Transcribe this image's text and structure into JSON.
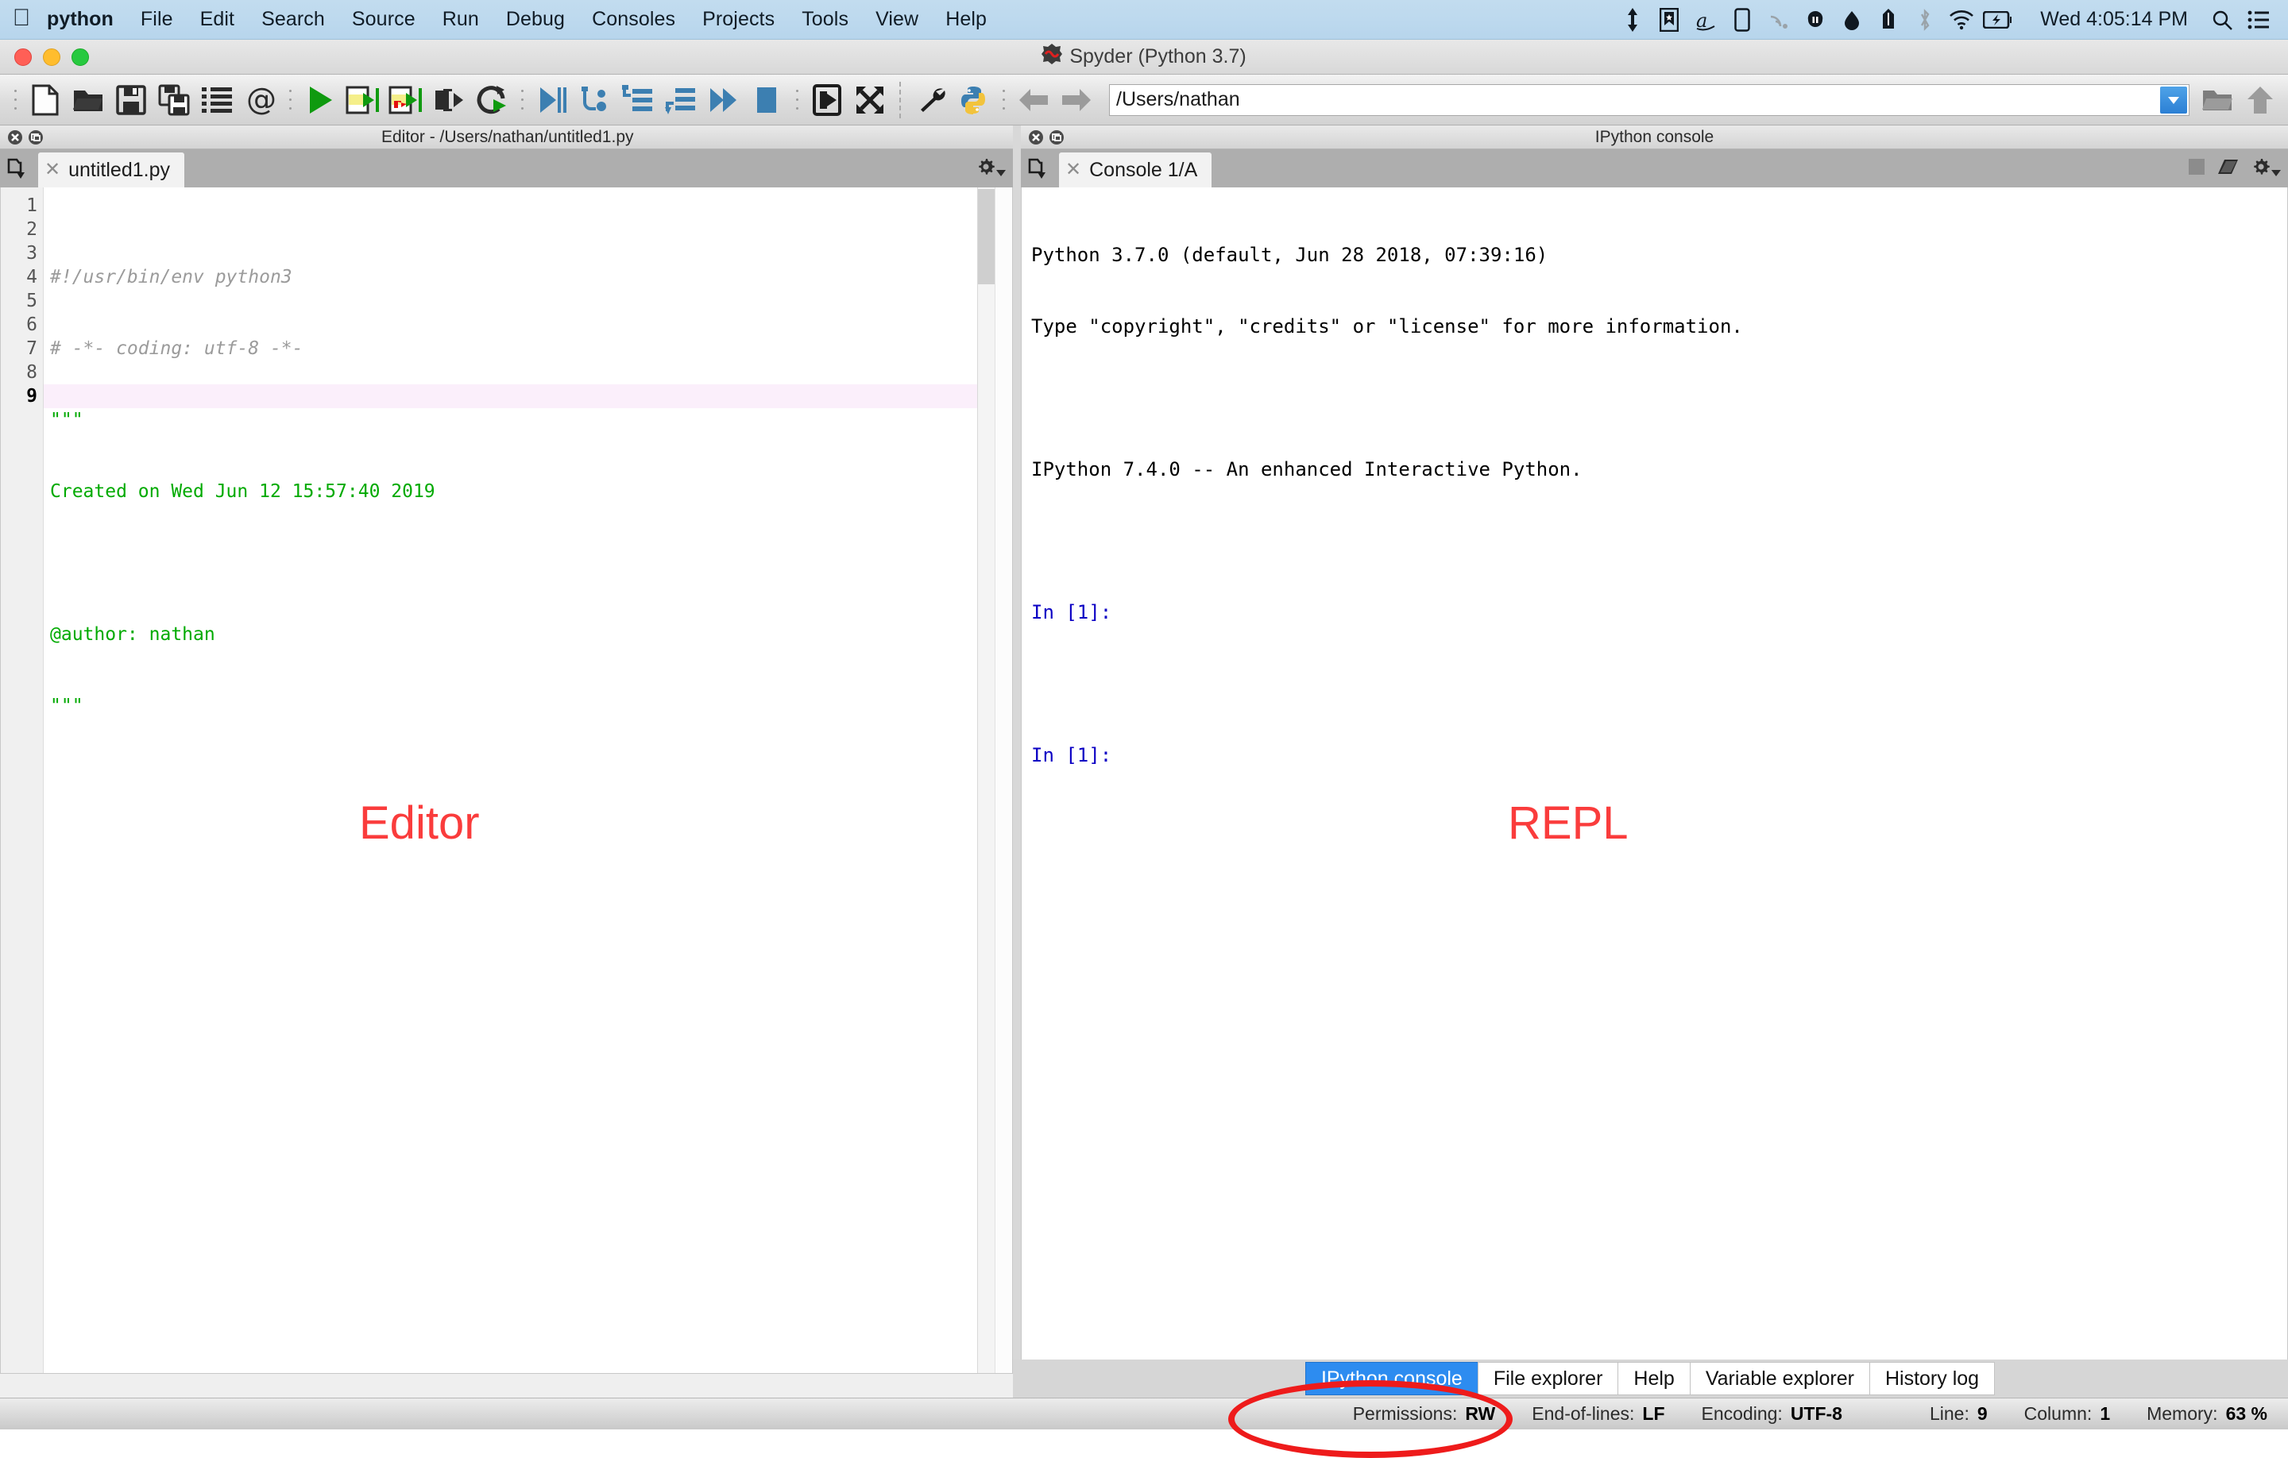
{
  "menubar": {
    "apple_icon": "apple-logo-icon",
    "app_name": "python",
    "items": [
      "File",
      "Edit",
      "Search",
      "Source",
      "Run",
      "Debug",
      "Consoles",
      "Projects",
      "Tools",
      "View",
      "Help"
    ],
    "tray_icons": [
      "updown-arrows-icon",
      "bookmark-star-icon",
      "script-a-icon",
      "phone-icon",
      "airdrop-icon",
      "dropbox-icon",
      "cloud-icon",
      "evernote-icon",
      "bluetooth-icon",
      "wifi-icon",
      "battery-charging-icon"
    ],
    "clock": "Wed 4:05:14 PM",
    "search_icon": "spotlight-search-icon",
    "control_center_icon": "notification-center-icon"
  },
  "window": {
    "title": "Spyder (Python 3.7)",
    "app_icon": "spyder-logo-icon"
  },
  "toolbar": {
    "buttons": [
      {
        "name": "new-file-button",
        "icon": "new-file-icon"
      },
      {
        "name": "open-file-button",
        "icon": "open-folder-icon"
      },
      {
        "name": "save-file-button",
        "icon": "floppy-save-icon"
      },
      {
        "name": "save-all-button",
        "icon": "save-all-icon"
      },
      {
        "name": "file-switcher-button",
        "icon": "list-icon"
      },
      {
        "name": "find-symbols-button",
        "icon": "at-sign-icon"
      },
      {
        "name": "run-file-button",
        "icon": "run-play-icon"
      },
      {
        "name": "run-cell-button",
        "icon": "run-cell-icon"
      },
      {
        "name": "run-cell-advance-button",
        "icon": "run-cell-advance-icon"
      },
      {
        "name": "run-selection-button",
        "icon": "run-selection-icon"
      },
      {
        "name": "re-run-button",
        "icon": "rerun-refresh-icon"
      },
      {
        "name": "debug-file-button",
        "icon": "debug-start-icon"
      },
      {
        "name": "debug-step-button",
        "icon": "debug-step-icon"
      },
      {
        "name": "debug-step-into-button",
        "icon": "debug-step-into-icon"
      },
      {
        "name": "debug-step-return-button",
        "icon": "debug-step-return-icon"
      },
      {
        "name": "debug-continue-button",
        "icon": "debug-continue-icon"
      },
      {
        "name": "debug-stop-button",
        "icon": "debug-stop-icon"
      },
      {
        "name": "maximize-pane-button",
        "icon": "maximize-pane-icon"
      },
      {
        "name": "fullscreen-button",
        "icon": "fullscreen-arrows-icon"
      },
      {
        "name": "preferences-button",
        "icon": "wrench-icon"
      },
      {
        "name": "pythonpath-manager-button",
        "icon": "python-logo-icon"
      },
      {
        "name": "back-button",
        "icon": "arrow-left-icon"
      },
      {
        "name": "forward-button",
        "icon": "arrow-right-icon"
      }
    ],
    "path_value": "/Users/nathan",
    "path_dropdown_icon": "chevron-down-icon",
    "browse_button_icon": "open-folder-icon",
    "parent_dir_button_icon": "arrow-up-icon"
  },
  "editor_pane": {
    "title": "Editor - /Users/nathan/untitled1.py",
    "close_icon": "close-pane-icon",
    "undock_icon": "undock-pane-icon",
    "browse_tabs_icon": "browse-tabs-icon",
    "options_icon": "gear-icon",
    "tab": {
      "label": "untitled1.py",
      "close_icon": "close-tab-icon"
    },
    "line_numbers": [
      "1",
      "2",
      "3",
      "4",
      "5",
      "6",
      "7",
      "8",
      "9"
    ],
    "current_line": 9,
    "code_lines": [
      {
        "text": "#!/usr/bin/env python3",
        "style": "cmt"
      },
      {
        "text": "# -*- coding: utf-8 -*-",
        "style": "cmt"
      },
      {
        "text": "\"\"\"",
        "style": "str"
      },
      {
        "text": "Created on Wed Jun 12 15:57:40 2019",
        "style": "str"
      },
      {
        "text": "",
        "style": "str"
      },
      {
        "text": "@author: nathan",
        "style": "str"
      },
      {
        "text": "\"\"\"",
        "style": "str"
      },
      {
        "text": "",
        "style": "none"
      },
      {
        "text": "",
        "style": "none"
      }
    ],
    "overlay_label": "Editor"
  },
  "console_pane": {
    "title": "IPython console",
    "close_icon": "close-pane-icon",
    "undock_icon": "undock-pane-icon",
    "browse_tabs_icon": "browse-tabs-icon",
    "stop_icon": "stop-square-icon",
    "clear_icon": "eraser-icon",
    "options_icon": "gear-icon",
    "tab": {
      "label": "Console 1/A",
      "close_icon": "close-tab-icon"
    },
    "output_lines": [
      "Python 3.7.0 (default, Jun 28 2018, 07:39:16)",
      "Type \"copyright\", \"credits\" or \"license\" for more information.",
      "",
      "IPython 7.4.0 -- An enhanced Interactive Python.",
      ""
    ],
    "prompts": [
      "In [1]:",
      "In [1]:"
    ],
    "overlay_label": "REPL"
  },
  "bottom_tabs": {
    "items": [
      "IPython console",
      "File explorer",
      "Help",
      "Variable explorer",
      "History log"
    ],
    "active": "IPython console",
    "annotation": "red-ellipse-highlight"
  },
  "statusbar": {
    "fields": [
      {
        "key": "Permissions:",
        "value": "RW"
      },
      {
        "key": "End-of-lines:",
        "value": "LF"
      },
      {
        "key": "Encoding:",
        "value": "UTF-8"
      },
      {
        "key": "Line:",
        "value": "9"
      },
      {
        "key": "Column:",
        "value": "1"
      },
      {
        "key": "Memory:",
        "value": "63 %"
      }
    ]
  },
  "colors": {
    "menubar_bg": "#bdd9ee",
    "accent_blue": "#2d8cf0",
    "annotation_red": "#ee1b1b",
    "overlay_red": "#fa3c3c",
    "comment_gray": "#9b9b9b",
    "string_green": "#00aa00",
    "prompt_blue": "#0b00c4",
    "current_line_bg": "#fbeffb"
  }
}
